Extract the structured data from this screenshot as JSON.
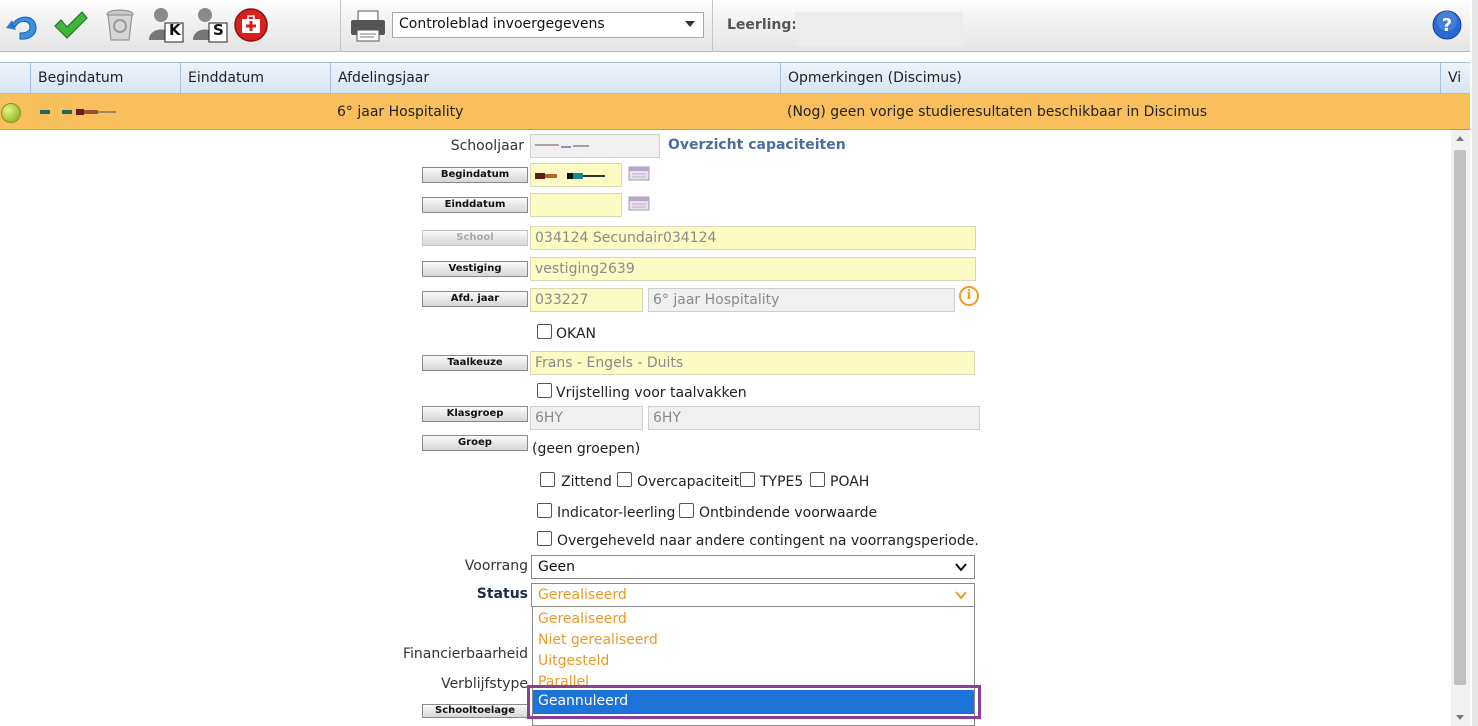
{
  "toolbar": {
    "icons": [
      "undo-icon",
      "checkmark-icon",
      "trash-icon",
      "user-k-icon",
      "user-s-icon",
      "first-aid-icon",
      "printer-icon",
      "help-icon"
    ],
    "user_k_letter": "K",
    "user_s_letter": "S",
    "report_select": "Controleblad invoergegevens",
    "leerling_label": "Leerling:",
    "help_glyph": "?"
  },
  "grid": {
    "columns": [
      "Begindatum",
      "Einddatum",
      "Afdelingsjaar",
      "Opmerkingen (Discimus)",
      "Vi"
    ],
    "row": {
      "afdelingsjaar": "6° jaar Hospitality",
      "opmerkingen": "(Nog) geen vorige studieresultaten beschikbaar in Discimus",
      "row_color": "#f9bf5c"
    }
  },
  "form": {
    "schooljaar_label": "Schooljaar",
    "overzicht_link": "Overzicht capaciteiten",
    "begindatum_btn": "Begindatum",
    "einddatum_btn": "Einddatum",
    "school_btn": "School",
    "school_value": "034124 Secundair034124",
    "vestiging_btn": "Vestiging",
    "vestiging_value": "vestiging2639",
    "afdjaar_btn": "Afd. jaar",
    "afdjaar_code": "033227",
    "afdjaar_name": "6° jaar Hospitality",
    "info_glyph": "i",
    "okan_label": "OKAN",
    "taalkeuze_btn": "Taalkeuze",
    "taalkeuze_value": "Frans - Engels - Duits",
    "vrijstelling_label": "Vrijstelling voor taalvakken",
    "klasgroep_btn": "Klasgroep",
    "klasgroep_code": "6HY",
    "klasgroep_name": "6HY",
    "groep_btn": "Groep",
    "groep_value": "(geen groepen)",
    "zittend_label": "Zittend",
    "overcapaciteit_label": "Overcapaciteit",
    "type5_label": "TYPE5",
    "poah_label": "POAH",
    "indicator_label": "Indicator-leerling",
    "ontbindende_label": "Ontbindende voorwaarde",
    "overgeheveld_label": "Overgeheveld naar andere contingent na voorrangsperiode.",
    "voorrang_label": "Voorrang",
    "voorrang_value": "Geen",
    "status_label": "Status",
    "status_value": "Gerealiseerd",
    "financierbaarheid_label": "Financierbaarheid",
    "verblijfstype_label": "Verblijfstype",
    "schooltoelage_btn": "Schooltoelage"
  },
  "status_dropdown": {
    "options": [
      "Gerealiseerd",
      "Niet gerealiseerd",
      "Uitgesteld",
      "Parallel"
    ],
    "selected": "Geannuleerd",
    "option_color": "#e89a2a",
    "selected_bg": "#1e74d6",
    "highlight_color": "#8b3f8f"
  }
}
